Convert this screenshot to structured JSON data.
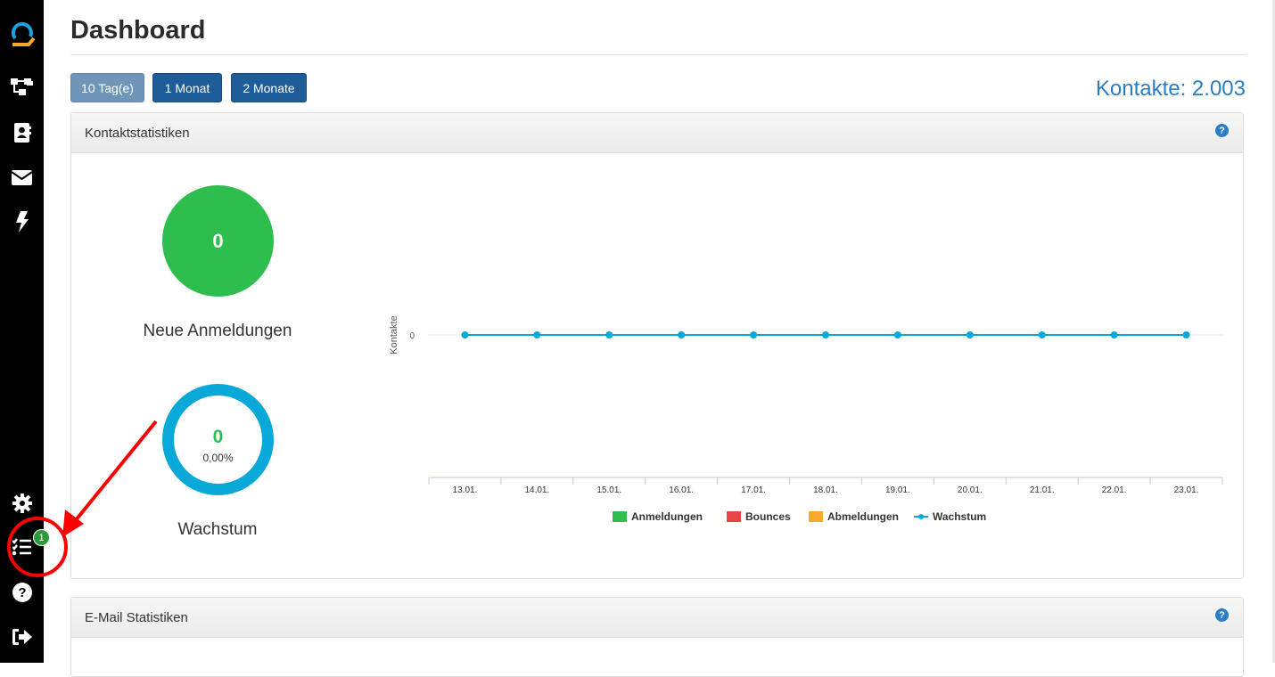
{
  "page": {
    "title": "Dashboard"
  },
  "sidebar": {
    "items": [
      {
        "name": "logo-icon"
      },
      {
        "name": "workflow-icon"
      },
      {
        "name": "contacts-icon"
      },
      {
        "name": "mail-icon"
      },
      {
        "name": "lightning-icon"
      },
      {
        "name": "gear-icon"
      },
      {
        "name": "tasks-icon"
      },
      {
        "name": "help-icon"
      },
      {
        "name": "logout-icon"
      }
    ],
    "tasks_badge": "1"
  },
  "filters": {
    "days10": "10 Tag(e)",
    "month1": "1 Monat",
    "month2": "2 Monate"
  },
  "kontakte_total": "Kontakte: 2.003",
  "panels": {
    "kontaktstatistiken": {
      "title": "Kontaktstatistiken",
      "neue_anmeldungen": {
        "value": "0",
        "label": "Neue Anmeldungen"
      },
      "wachstum": {
        "value": "0",
        "percent": "0,00%",
        "label": "Wachstum"
      }
    },
    "email": {
      "title": "E-Mail Statistiken"
    }
  },
  "colors": {
    "sidebar": "#000000",
    "accent": "#2a7ec3",
    "green": "#2dbe4e",
    "red": "#e84545",
    "orange": "#f7a92a",
    "cyan": "#08a8d9",
    "annotation": "#ff0000"
  },
  "chart_data": {
    "type": "line",
    "ylabel": "Kontakte",
    "xlabel": "",
    "categories": [
      "13.01.",
      "14.01.",
      "15.01.",
      "16.01.",
      "17.01.",
      "18.01.",
      "19.01.",
      "20.01.",
      "21.01.",
      "22.01.",
      "23.01."
    ],
    "series": [
      {
        "name": "Anmeldungen",
        "type": "bar",
        "color": "#2dbe4e",
        "values": [
          0,
          0,
          0,
          0,
          0,
          0,
          0,
          0,
          0,
          0,
          0
        ]
      },
      {
        "name": "Bounces",
        "type": "bar",
        "color": "#e84545",
        "values": [
          0,
          0,
          0,
          0,
          0,
          0,
          0,
          0,
          0,
          0,
          0
        ]
      },
      {
        "name": "Abmeldungen",
        "type": "bar",
        "color": "#f7a92a",
        "values": [
          0,
          0,
          0,
          0,
          0,
          0,
          0,
          0,
          0,
          0,
          0
        ]
      },
      {
        "name": "Wachstum",
        "type": "line",
        "color": "#08a8d9",
        "values": [
          0,
          0,
          0,
          0,
          0,
          0,
          0,
          0,
          0,
          0,
          0
        ]
      }
    ],
    "yticks": [
      "0"
    ],
    "legend": "bottom"
  }
}
